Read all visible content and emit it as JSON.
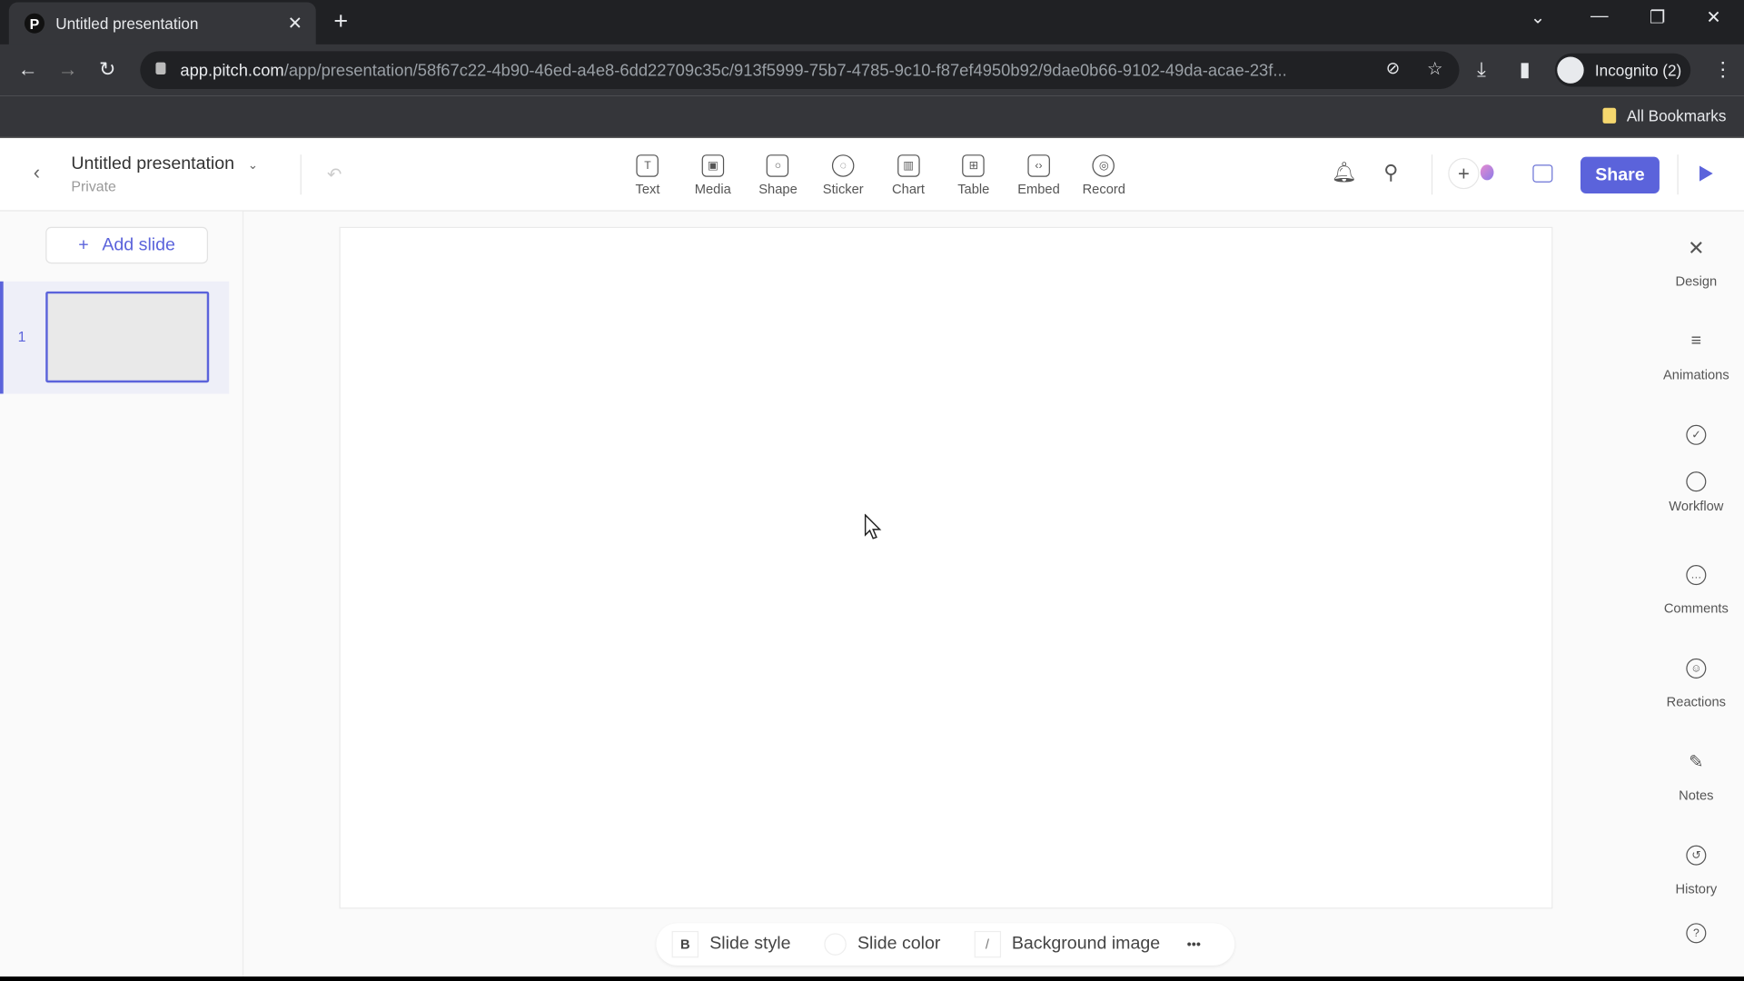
{
  "browser": {
    "tab_title": "Untitled presentation",
    "url_host": "app.pitch.com",
    "url_path": "/app/presentation/58f67c22-4b90-46ed-a4e8-6dd22709c35c/913f5999-75b7-4785-9c10-f87ef4950b92/9dae0b66-9102-49da-acae-23f...",
    "profile": "Incognito (2)",
    "bookmarks": "All Bookmarks"
  },
  "header": {
    "title": "Untitled presentation",
    "visibility": "Private",
    "share": "Share"
  },
  "tools": [
    {
      "label": "Text",
      "glyph": "T"
    },
    {
      "label": "Media",
      "glyph": "▣"
    },
    {
      "label": "Shape",
      "glyph": "○"
    },
    {
      "label": "Sticker",
      "glyph": "◌"
    },
    {
      "label": "Chart",
      "glyph": "▥"
    },
    {
      "label": "Table",
      "glyph": "⊞"
    },
    {
      "label": "Embed",
      "glyph": "‹›"
    },
    {
      "label": "Record",
      "glyph": "◎"
    }
  ],
  "sidebar": {
    "add_slide": "Add slide",
    "slides": [
      {
        "number": "1"
      }
    ]
  },
  "right_panel": [
    {
      "label": "Design",
      "glyph": "✕"
    },
    {
      "label": "Animations",
      "glyph": "≡"
    },
    {
      "label": "Workflow",
      "glyph": "✓"
    },
    {
      "label": "Comments",
      "glyph": "…"
    },
    {
      "label": "Reactions",
      "glyph": "☺"
    },
    {
      "label": "Notes",
      "glyph": "✎"
    },
    {
      "label": "History",
      "glyph": "↺"
    }
  ],
  "bottom_bar": {
    "slide_style": "Slide style",
    "slide_color": "Slide color",
    "background_image": "Background image",
    "more": "•••",
    "style_glyph": "B"
  },
  "colors": {
    "accent": "#5b63db"
  }
}
